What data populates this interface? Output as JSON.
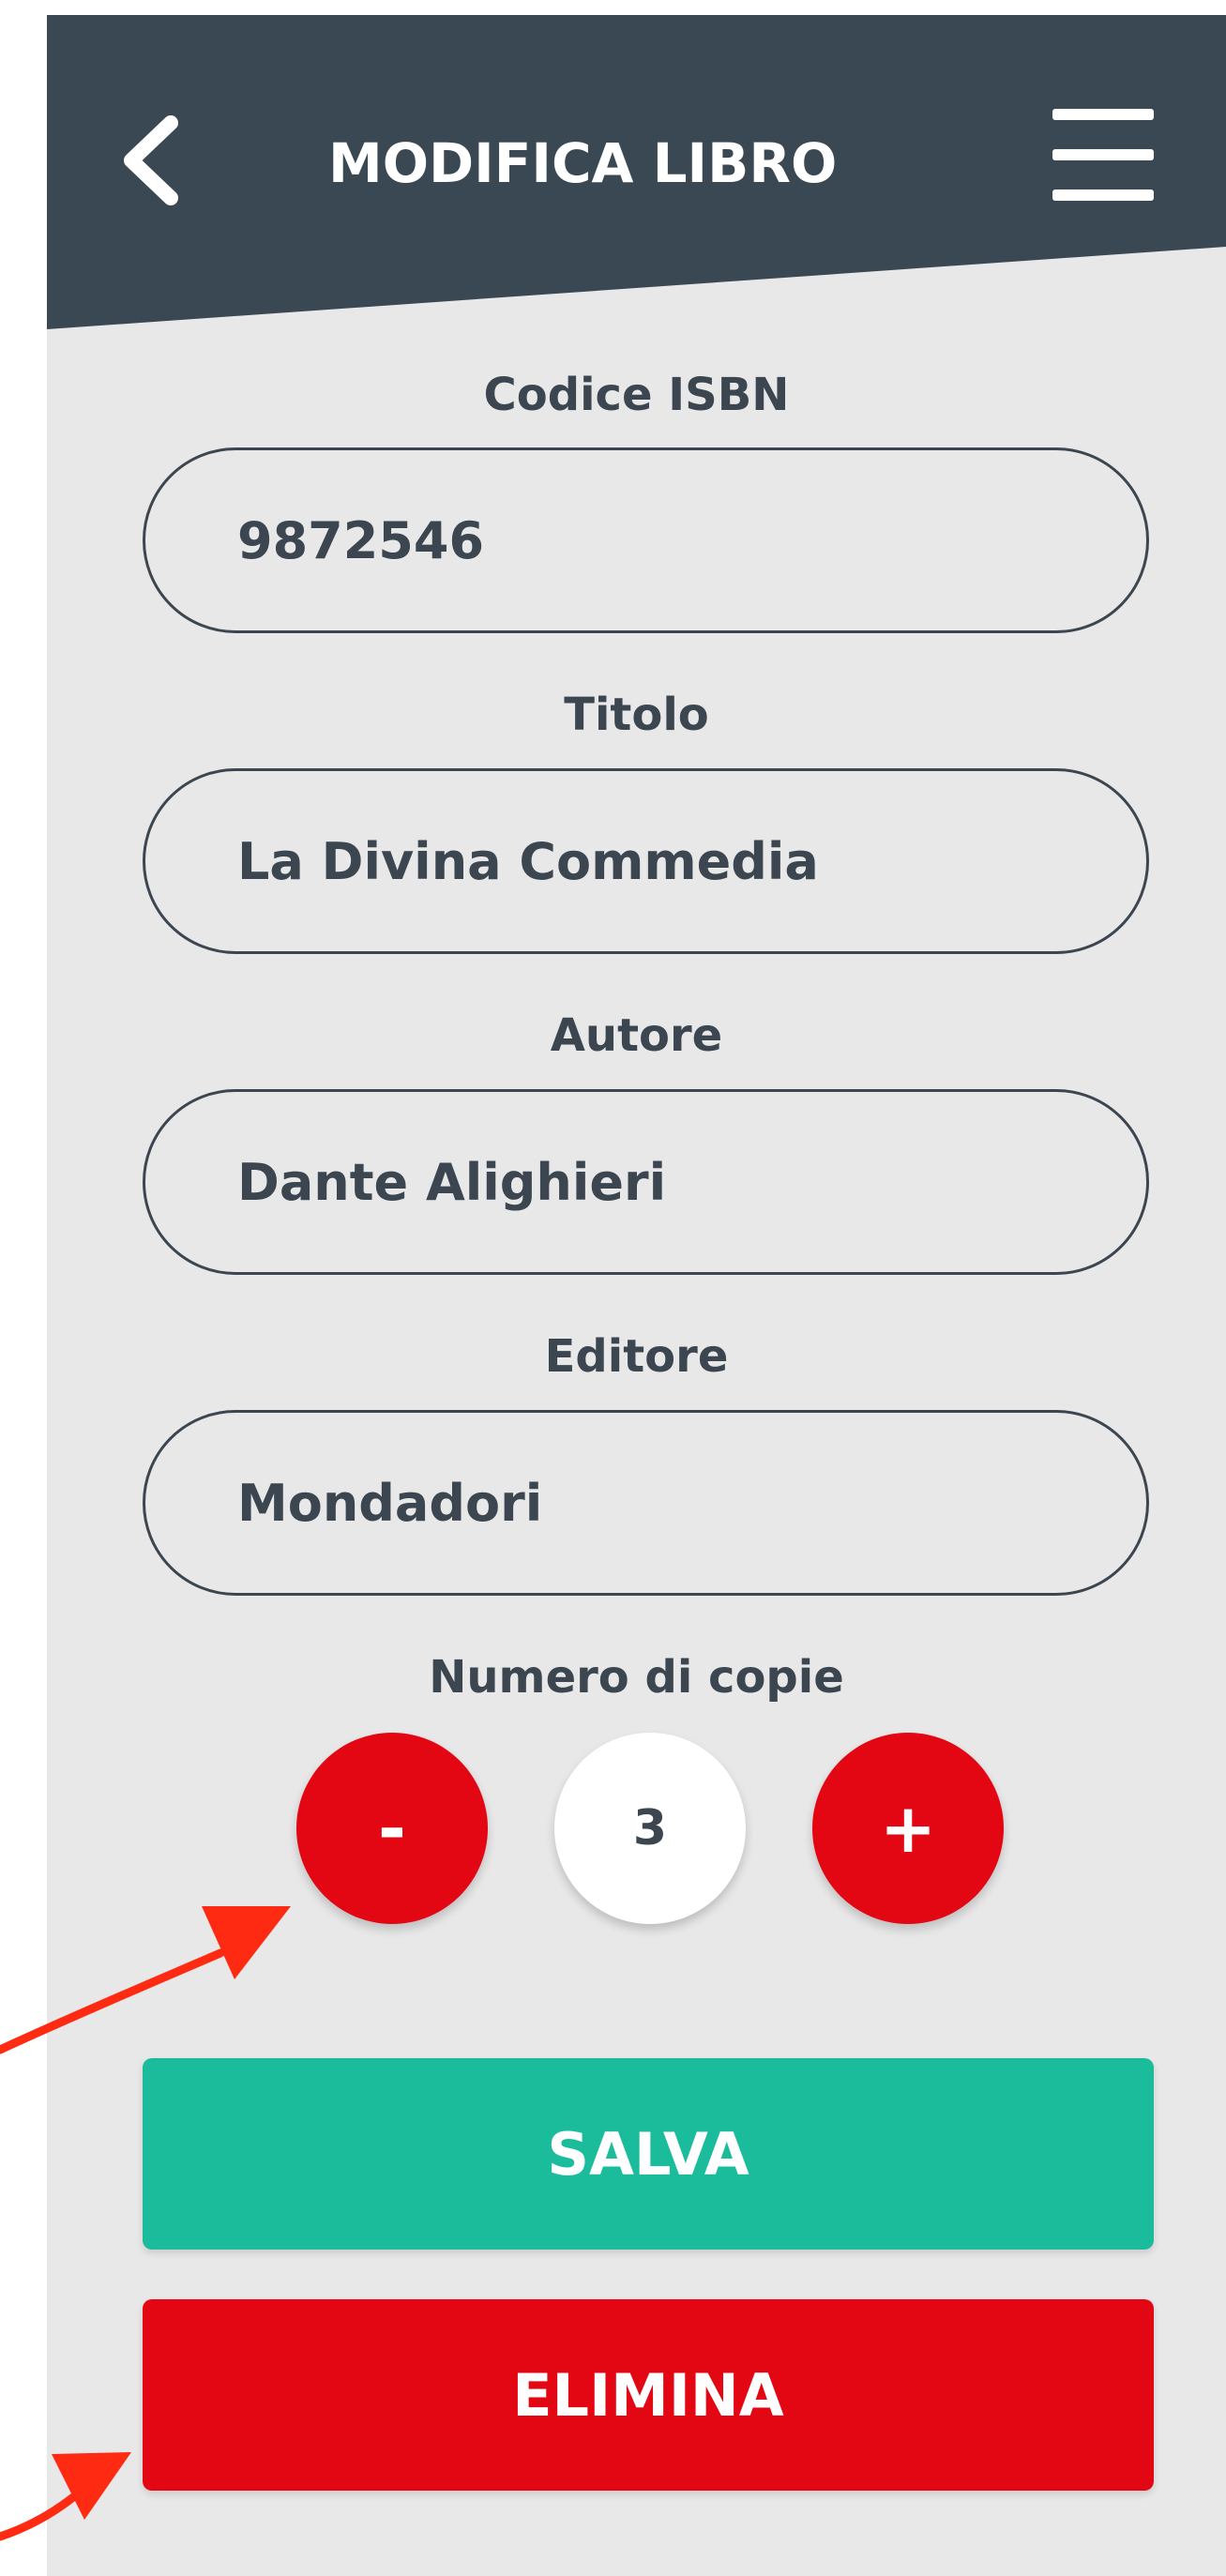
{
  "header": {
    "title": "MODIFICA LIBRO",
    "background_color": "#394852",
    "back_icon": "chevron-left-icon",
    "menu_icon": "hamburger-menu-icon"
  },
  "form": {
    "isbn": {
      "label": "Codice ISBN",
      "value": "9872546"
    },
    "title": {
      "label": "Titolo",
      "value": "La Divina Commedia"
    },
    "author": {
      "label": "Autore",
      "value": "Dante Alighieri"
    },
    "publisher": {
      "label": "Editore",
      "value": "Mondadori"
    }
  },
  "copies": {
    "label": "Numero di copie",
    "decrement_label": "-",
    "value": "3",
    "increment_label": "+",
    "accent_color": "#e30613"
  },
  "actions": {
    "save_label": "SALVA",
    "save_color": "#1abc9c",
    "delete_label": "ELIMINA",
    "delete_color": "#e30613"
  },
  "annotations": {
    "arrow_color": "#ff2a12"
  }
}
